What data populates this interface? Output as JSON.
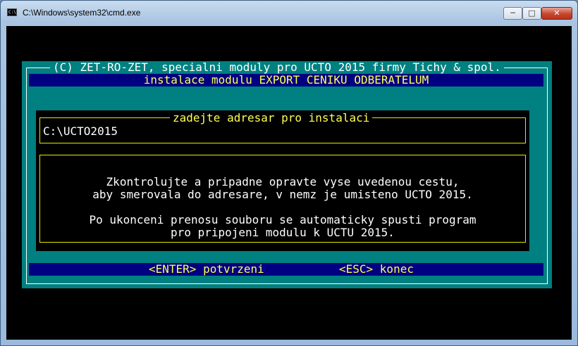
{
  "window": {
    "title": "C:\\Windows\\system32\\cmd.exe",
    "icon_name": "cmd-console-icon",
    "icon_text": "C:\\",
    "min_glyph": "─",
    "max_glyph": "□",
    "close_glyph": "✕"
  },
  "dialog": {
    "copyright": "(C) ZET-RO-ZET, specialni moduly pro UCTO 2015 firmy Tichy & spol.",
    "subtitle": "instalace modulu EXPORT CENIKU ODBERATELUM",
    "path_legend": "zadejte adresar pro instalaci",
    "path_value": "C:\\UCTO2015",
    "message": [
      "Zkontrolujte a pripadne opravte vyse uvedenou cestu,",
      "aby smerovala do adresare, v nemz je umisteno UCTO 2015.",
      "Po ukonceni prenosu souboru se automaticky spusti program",
      "pro pripojeni modulu k UCTU 2015."
    ],
    "enter_hint": "<ENTER> potvrzeni",
    "esc_hint": "<ESC> konec"
  },
  "colors": {
    "dialog_bg": "#008080",
    "bar_bg": "#000080",
    "highlight_text": "#ffff55",
    "console_bg": "#000000"
  }
}
